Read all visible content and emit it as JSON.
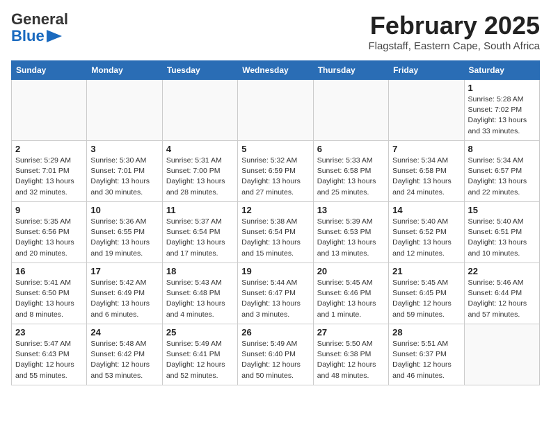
{
  "header": {
    "logo_general": "General",
    "logo_blue": "Blue",
    "month": "February 2025",
    "location": "Flagstaff, Eastern Cape, South Africa"
  },
  "weekdays": [
    "Sunday",
    "Monday",
    "Tuesday",
    "Wednesday",
    "Thursday",
    "Friday",
    "Saturday"
  ],
  "weeks": [
    [
      {
        "day": "",
        "info": ""
      },
      {
        "day": "",
        "info": ""
      },
      {
        "day": "",
        "info": ""
      },
      {
        "day": "",
        "info": ""
      },
      {
        "day": "",
        "info": ""
      },
      {
        "day": "",
        "info": ""
      },
      {
        "day": "1",
        "info": "Sunrise: 5:28 AM\nSunset: 7:02 PM\nDaylight: 13 hours\nand 33 minutes."
      }
    ],
    [
      {
        "day": "2",
        "info": "Sunrise: 5:29 AM\nSunset: 7:01 PM\nDaylight: 13 hours\nand 32 minutes."
      },
      {
        "day": "3",
        "info": "Sunrise: 5:30 AM\nSunset: 7:01 PM\nDaylight: 13 hours\nand 30 minutes."
      },
      {
        "day": "4",
        "info": "Sunrise: 5:31 AM\nSunset: 7:00 PM\nDaylight: 13 hours\nand 28 minutes."
      },
      {
        "day": "5",
        "info": "Sunrise: 5:32 AM\nSunset: 6:59 PM\nDaylight: 13 hours\nand 27 minutes."
      },
      {
        "day": "6",
        "info": "Sunrise: 5:33 AM\nSunset: 6:58 PM\nDaylight: 13 hours\nand 25 minutes."
      },
      {
        "day": "7",
        "info": "Sunrise: 5:34 AM\nSunset: 6:58 PM\nDaylight: 13 hours\nand 24 minutes."
      },
      {
        "day": "8",
        "info": "Sunrise: 5:34 AM\nSunset: 6:57 PM\nDaylight: 13 hours\nand 22 minutes."
      }
    ],
    [
      {
        "day": "9",
        "info": "Sunrise: 5:35 AM\nSunset: 6:56 PM\nDaylight: 13 hours\nand 20 minutes."
      },
      {
        "day": "10",
        "info": "Sunrise: 5:36 AM\nSunset: 6:55 PM\nDaylight: 13 hours\nand 19 minutes."
      },
      {
        "day": "11",
        "info": "Sunrise: 5:37 AM\nSunset: 6:54 PM\nDaylight: 13 hours\nand 17 minutes."
      },
      {
        "day": "12",
        "info": "Sunrise: 5:38 AM\nSunset: 6:54 PM\nDaylight: 13 hours\nand 15 minutes."
      },
      {
        "day": "13",
        "info": "Sunrise: 5:39 AM\nSunset: 6:53 PM\nDaylight: 13 hours\nand 13 minutes."
      },
      {
        "day": "14",
        "info": "Sunrise: 5:40 AM\nSunset: 6:52 PM\nDaylight: 13 hours\nand 12 minutes."
      },
      {
        "day": "15",
        "info": "Sunrise: 5:40 AM\nSunset: 6:51 PM\nDaylight: 13 hours\nand 10 minutes."
      }
    ],
    [
      {
        "day": "16",
        "info": "Sunrise: 5:41 AM\nSunset: 6:50 PM\nDaylight: 13 hours\nand 8 minutes."
      },
      {
        "day": "17",
        "info": "Sunrise: 5:42 AM\nSunset: 6:49 PM\nDaylight: 13 hours\nand 6 minutes."
      },
      {
        "day": "18",
        "info": "Sunrise: 5:43 AM\nSunset: 6:48 PM\nDaylight: 13 hours\nand 4 minutes."
      },
      {
        "day": "19",
        "info": "Sunrise: 5:44 AM\nSunset: 6:47 PM\nDaylight: 13 hours\nand 3 minutes."
      },
      {
        "day": "20",
        "info": "Sunrise: 5:45 AM\nSunset: 6:46 PM\nDaylight: 13 hours\nand 1 minute."
      },
      {
        "day": "21",
        "info": "Sunrise: 5:45 AM\nSunset: 6:45 PM\nDaylight: 12 hours\nand 59 minutes."
      },
      {
        "day": "22",
        "info": "Sunrise: 5:46 AM\nSunset: 6:44 PM\nDaylight: 12 hours\nand 57 minutes."
      }
    ],
    [
      {
        "day": "23",
        "info": "Sunrise: 5:47 AM\nSunset: 6:43 PM\nDaylight: 12 hours\nand 55 minutes."
      },
      {
        "day": "24",
        "info": "Sunrise: 5:48 AM\nSunset: 6:42 PM\nDaylight: 12 hours\nand 53 minutes."
      },
      {
        "day": "25",
        "info": "Sunrise: 5:49 AM\nSunset: 6:41 PM\nDaylight: 12 hours\nand 52 minutes."
      },
      {
        "day": "26",
        "info": "Sunrise: 5:49 AM\nSunset: 6:40 PM\nDaylight: 12 hours\nand 50 minutes."
      },
      {
        "day": "27",
        "info": "Sunrise: 5:50 AM\nSunset: 6:38 PM\nDaylight: 12 hours\nand 48 minutes."
      },
      {
        "day": "28",
        "info": "Sunrise: 5:51 AM\nSunset: 6:37 PM\nDaylight: 12 hours\nand 46 minutes."
      },
      {
        "day": "",
        "info": ""
      }
    ]
  ]
}
